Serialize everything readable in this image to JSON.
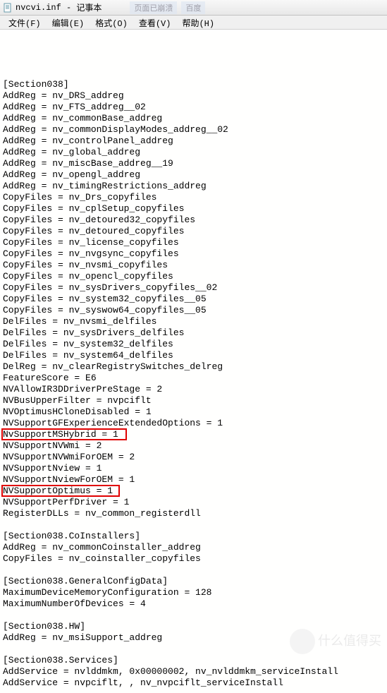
{
  "titlebar": {
    "filename": "nvcvi.inf",
    "app": "记事本"
  },
  "other_tabs": {
    "t1": "页面已崩溃",
    "t2": "百度"
  },
  "menu": {
    "file": "文件(F)",
    "edit": "编辑(E)",
    "format": "格式(O)",
    "view": "查看(V)",
    "help": "帮助(H)"
  },
  "lines": [
    "",
    "[Section038]",
    "AddReg = nv_DRS_addreg",
    "AddReg = nv_FTS_addreg__02",
    "AddReg = nv_commonBase_addreg",
    "AddReg = nv_commonDisplayModes_addreg__02",
    "AddReg = nv_controlPanel_addreg",
    "AddReg = nv_global_addreg",
    "AddReg = nv_miscBase_addreg__19",
    "AddReg = nv_opengl_addreg",
    "AddReg = nv_timingRestrictions_addreg",
    "CopyFiles = nv_Drs_copyfiles",
    "CopyFiles = nv_cplSetup_copyfiles",
    "CopyFiles = nv_detoured32_copyfiles",
    "CopyFiles = nv_detoured_copyfiles",
    "CopyFiles = nv_license_copyfiles",
    "CopyFiles = nv_nvgsync_copyfiles",
    "CopyFiles = nv_nvsmi_copyfiles",
    "CopyFiles = nv_opencl_copyfiles",
    "CopyFiles = nv_sysDrivers_copyfiles__02",
    "CopyFiles = nv_system32_copyfiles__05",
    "CopyFiles = nv_syswow64_copyfiles__05",
    "DelFiles = nv_nvsmi_delfiles",
    "DelFiles = nv_sysDrivers_delfiles",
    "DelFiles = nv_system32_delfiles",
    "DelFiles = nv_system64_delfiles",
    "DelReg = nv_clearRegistrySwitches_delreg",
    "FeatureScore = E6",
    "NVAllowIR3DDriverPreStage = 2",
    "NVBusUpperFilter = nvpciflt",
    "NVOptimusHCloneDisabled = 1",
    "NVSupportGFExperienceExtendedOptions = 1",
    "NvSupportMSHybrid = 1",
    "NVSupportNVWmi = 2",
    "NVSupportNVWmiForOEM = 2",
    "NVSupportNview = 1",
    "NVSupportNviewForOEM = 1",
    "NVSupportOptimus = 1",
    "NVSupportPerfDriver = 1",
    "RegisterDLLs = nv_common_registerdll",
    "",
    "[Section038.CoInstallers]",
    "AddReg = nv_commonCoinstaller_addreg",
    "CopyFiles = nv_coinstaller_copyfiles",
    "",
    "[Section038.GeneralConfigData]",
    "MaximumDeviceMemoryConfiguration = 128",
    "MaximumNumberOfDevices = 4",
    "",
    "[Section038.HW]",
    "AddReg = nv_msiSupport_addreg",
    "",
    "[Section038.Services]",
    "AddService = nvlddmkm, 0x00000002, nv_nvlddmkm_serviceInstall",
    "AddService = nvpciflt, , nv_nvpciflt_serviceInstall"
  ],
  "watermark": {
    "text": "什么值得买"
  }
}
